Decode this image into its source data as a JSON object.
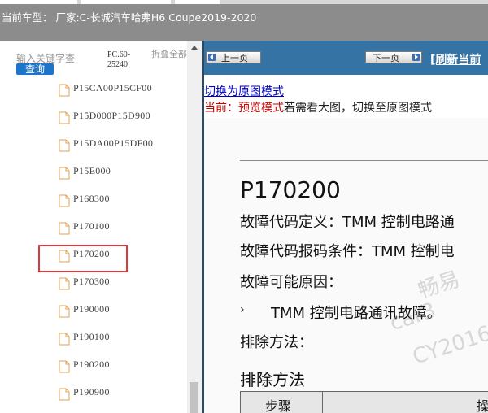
{
  "header": {
    "car_model": "当前车型： 厂家:C-长城汽车哈弗H6 Coupe2019-2020"
  },
  "sidebar": {
    "search_placeholder": "输入关键字查",
    "query_button": "查询",
    "pc_version": "PC.60-25240",
    "collapse_all": "折叠全部",
    "items": [
      {
        "label": "P15CA00P15CF00"
      },
      {
        "label": "P15D000P15D900"
      },
      {
        "label": "P15DA00P15DF00"
      },
      {
        "label": "P15E000"
      },
      {
        "label": "P168300"
      },
      {
        "label": "P170100"
      },
      {
        "label": "P170200",
        "selected": true
      },
      {
        "label": "P170300"
      },
      {
        "label": "P190000"
      },
      {
        "label": "P190100"
      },
      {
        "label": "P190200"
      },
      {
        "label": "P190900"
      }
    ]
  },
  "toolbar": {
    "prev_label": "上一页",
    "next_label": "下一页",
    "refresh_label": "[刷新当前"
  },
  "content": {
    "switch_link": "切换为原图模式",
    "mode_prefix": "当前：预览模式",
    "mode_suffix": "若需看大图，切换至原图模式",
    "doc": {
      "code": "P170200",
      "definition": "故障代码定义：TMM 控制电路通",
      "condition": "故障代码报码条件：TMM 控制电",
      "causes_title": "故障可能原因：",
      "bullet": "›",
      "cause_1": "TMM 控制电路通讯故障。",
      "method_1": "排除方法：",
      "method_2": "排除方法",
      "table_header_step": "步骤",
      "table_header_op": "操"
    },
    "watermarks": [
      "畅易",
      "car3",
      "CY2016"
    ]
  },
  "colors": {
    "navbar": "#3573a5",
    "query_button": "#1e74c8",
    "highlight": "#d93a3a",
    "link": "#0000cc",
    "mode_red": "#cc0000"
  }
}
